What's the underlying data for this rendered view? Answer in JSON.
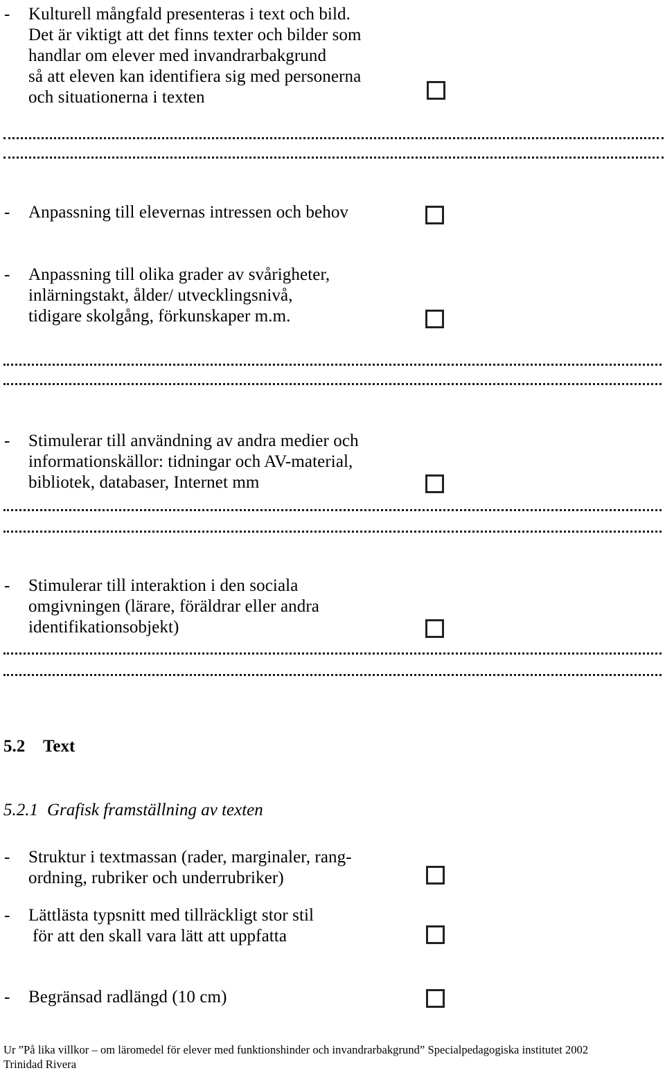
{
  "document": {
    "language": "sv",
    "sections": [
      {
        "id": "bullet-kulturell-mangfald",
        "bullet_marker": "-",
        "lines": [
          "Kulturell mångfald presenteras i text och bild.",
          "Det är viktigt att det finns texter och bilder som",
          "handlar om elever med invandrarbakgrund",
          "så att eleven kan identifiera sig med personerna",
          "och situationerna i texten"
        ],
        "has_checkbox": true,
        "checkbox_checked": false
      },
      {
        "id": "bullet-anpassning-intressen",
        "bullet_marker": "-",
        "lines": [
          "Anpassning till elevernas intressen och behov"
        ],
        "has_checkbox": true,
        "checkbox_checked": false
      },
      {
        "id": "bullet-anpassning-svarigheter",
        "bullet_marker": "-",
        "lines": [
          "Anpassning till olika grader av svårigheter,",
          "inlärningstakt, ålder/ utvecklingsnivå,",
          "tidigare skolgång, förkunskaper m.m."
        ],
        "has_checkbox": true,
        "checkbox_checked": false
      },
      {
        "id": "bullet-stimulerar-medier",
        "bullet_marker": "-",
        "lines": [
          "Stimulerar till användning av andra medier och",
          "informationskällor: tidningar och AV-material,",
          "bibliotek, databaser, Internet mm"
        ],
        "has_checkbox": true,
        "checkbox_checked": false
      },
      {
        "id": "bullet-stimulerar-interaktion",
        "bullet_marker": "-",
        "lines": [
          "Stimulerar till interaktion i den sociala",
          "omgivningen (lärare, föräldrar eller andra",
          "identifikationsobjekt)"
        ],
        "has_checkbox": true,
        "checkbox_checked": false
      },
      {
        "id": "bullet-struktur-textmassan",
        "bullet_marker": "-",
        "lines": [
          "Struktur i textmassan (rader, marginaler, rang-",
          "ordning, rubriker och underrubriker)"
        ],
        "has_checkbox": true,
        "checkbox_checked": false
      },
      {
        "id": "bullet-lattlasta-typsnitt",
        "bullet_marker": "-",
        "lines": [
          "Lättlästa typsnitt med tillräckligt stor stil",
          "för att den skall vara lätt att uppfatta"
        ],
        "has_checkbox": true,
        "checkbox_checked": false
      },
      {
        "id": "bullet-begransad-radlangd",
        "bullet_marker": "-",
        "lines": [
          "Begränsad radlängd (10 cm)"
        ],
        "has_checkbox": true,
        "checkbox_checked": false
      }
    ],
    "headings": {
      "section_5_2_number": "5.2",
      "section_5_2_title": "Text",
      "section_5_2_1_number": "5.2.1",
      "section_5_2_1_title": "Grafisk framställning av texten"
    },
    "footer": {
      "line1": "Ur ”På lika villkor – om läromedel för elever med funktionshinder och invandrarbakgrund” Specialpedagogiska institutet 2002",
      "line2": "Trinidad Rivera"
    },
    "colors": {
      "text": "#000000",
      "checkbox_border": "#222222",
      "dotted_rule": "#1a1a1a",
      "background": "#ffffff"
    }
  }
}
